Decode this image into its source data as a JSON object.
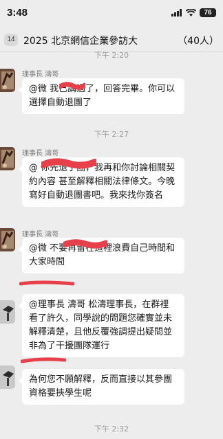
{
  "status_bar": {
    "time": "3:48",
    "battery": "76"
  },
  "header": {
    "back_badge": "14",
    "title": "2025 北京網信企業參訪大",
    "member_count": "（40人）"
  },
  "timestamps": [
    "下午 2:20",
    "下午 2:27",
    "下午 2:32"
  ],
  "messages": [
    {
      "sender": "理事長 濤哥",
      "text": "@微     我已講過了，回答完畢。你可以選擇自動退團了"
    },
    {
      "sender": "理事長 濤哥",
      "text": "@           你先退了團，我再和你討論相關契約內容 甚至解釋相關法律條文。今晚寫好自動退團書吧。我來找你簽名"
    },
    {
      "sender": "理事長 濤哥",
      "text": "@微            不要再留在這裡浪費自己時間和大家時間"
    },
    {
      "sender": "",
      "text": "@理事長 濤哥 松濤理事長，在群裡看了許久，同學說的問題您確實並未解釋清楚，且他反覆強調提出疑問並非為了干擾團隊運行"
    },
    {
      "sender": "",
      "text": "為何您不願解釋，反而直接以其參團資格要挾學生呢"
    }
  ],
  "colors": {
    "background": "#ededed",
    "bubble": "#ffffff",
    "redaction": "#e8404a"
  }
}
